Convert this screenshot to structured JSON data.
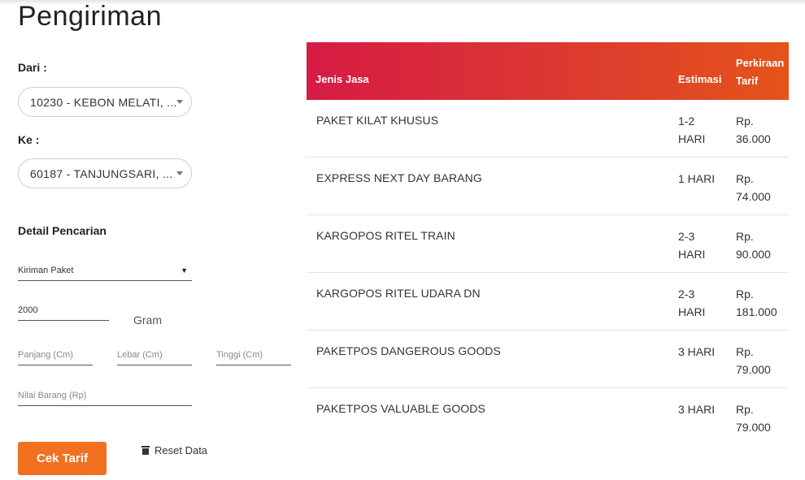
{
  "page": {
    "title": "Pengiriman"
  },
  "form": {
    "from_label": "Dari :",
    "from_value": "10230 - KEBON MELATI, ...",
    "to_label": "Ke :",
    "to_value": "60187 - TANJUNGSARI, ...",
    "detail_label": "Detail Pencarian",
    "type_value": "Kiriman Paket",
    "weight_value": "2000",
    "weight_unit": "Gram",
    "length_placeholder": "Panjang (Cm)",
    "width_placeholder": "Lebar (Cm)",
    "height_placeholder": "Tinggi (Cm)",
    "value_placeholder": "Nilai Barang (Rp)",
    "check_button": "Cek Tarif",
    "reset_button": "Reset Data"
  },
  "table": {
    "headers": [
      "Jenis Jasa",
      "Estimasi",
      "Perkiraan Tarif"
    ],
    "rows": [
      {
        "service": "PAKET KILAT KHUSUS",
        "estimate": "1-2 HARI",
        "price": "Rp. 36.000"
      },
      {
        "service": "EXPRESS NEXT DAY BARANG",
        "estimate": "1 HARI",
        "price": "Rp. 74.000"
      },
      {
        "service": "KARGOPOS RITEL TRAIN",
        "estimate": "2-3 HARI",
        "price": "Rp. 90.000"
      },
      {
        "service": "KARGOPOS RITEL UDARA DN",
        "estimate": "2-3 HARI",
        "price": "Rp. 181.000"
      },
      {
        "service": "PAKETPOS DANGEROUS GOODS",
        "estimate": "3 HARI",
        "price": "Rp. 79.000"
      },
      {
        "service": "PAKETPOS VALUABLE GOODS",
        "estimate": "3 HARI",
        "price": "Rp. 79.000"
      }
    ]
  },
  "colors": {
    "accent": "#f37021",
    "header_gradient_start": "#d61b44",
    "header_gradient_end": "#e4541a"
  },
  "icons": {
    "reset": "trash-icon",
    "select": "chevron-down-icon"
  }
}
